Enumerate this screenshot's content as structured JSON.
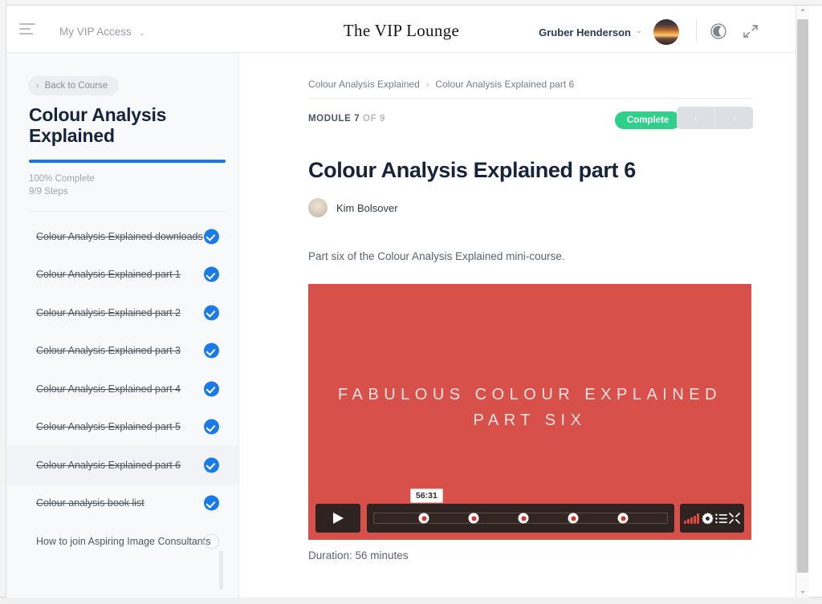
{
  "topbar": {
    "menu_icon": "hamburger-icon",
    "vip_access_label": "My VIP Access",
    "vip_access_caret": "⌄",
    "brand": "The VIP Lounge",
    "user_name": "Gruber Henderson",
    "user_caret": "⌄",
    "avatar_icon": "user-avatar",
    "moon_icon": "moon-icon",
    "expand_icon": "expand-icon"
  },
  "sidebar": {
    "back_label": "Back to Course",
    "back_chevron": "‹",
    "course_title": "Colour Analysis Explained",
    "progress_percent": 100,
    "progress_label": "100% Complete",
    "steps_label": "9/9 Steps",
    "lessons": [
      {
        "label": "Colour Analysis Explained downloads",
        "complete": true,
        "active": false
      },
      {
        "label": "Colour Analysis Explained part 1",
        "complete": true,
        "active": false
      },
      {
        "label": "Colour Analysis Explained part 2",
        "complete": true,
        "active": false
      },
      {
        "label": "Colour Analysis Explained part 3",
        "complete": true,
        "active": false
      },
      {
        "label": "Colour Analysis Explained part 4",
        "complete": true,
        "active": false
      },
      {
        "label": "Colour Analysis Explained part 5",
        "complete": true,
        "active": false
      },
      {
        "label": "Colour Analysis Explained part 6",
        "complete": true,
        "active": true
      },
      {
        "label": "Colour analysis book list",
        "complete": true,
        "active": false
      },
      {
        "label": "How to join Aspiring Image Consultants",
        "complete": false,
        "active": false
      }
    ]
  },
  "content": {
    "breadcrumb": {
      "parent": "Colour Analysis Explained",
      "separator": "›",
      "current": "Colour Analysis Explained part 6"
    },
    "module_label": "MODULE 7",
    "module_of": " OF 9",
    "complete_button": "Complete",
    "prev_arrow": "‹",
    "next_arrow": "›",
    "lesson_title": "Colour Analysis Explained part 6",
    "author": "Kim Bolsover",
    "description": "Part six of the Colour Analysis Explained mini-course.",
    "duration_note": "Duration: 56 minutes"
  },
  "video": {
    "title_line1": "FABULOUS COLOUR EXPLAINED",
    "title_line2": "PART SIX",
    "background_color": "#d8504a",
    "play_icon": "play-icon",
    "time_tooltip": "56:31",
    "chapter_positions": [
      17,
      34,
      51,
      68,
      85
    ],
    "volume_icon": "volume-icon",
    "settings_icon": "gear-icon",
    "playlist_icon": "playlist-icon",
    "fullscreen_icon": "fullscreen-icon"
  },
  "colors": {
    "accent_blue": "#1877e8",
    "complete_green": "#2ed08a",
    "video_red": "#d8504a",
    "sidebar_bg": "#f8f9fb"
  },
  "scrollbar": {
    "up_arrow": "⌃",
    "down_arrow": "⌄"
  }
}
